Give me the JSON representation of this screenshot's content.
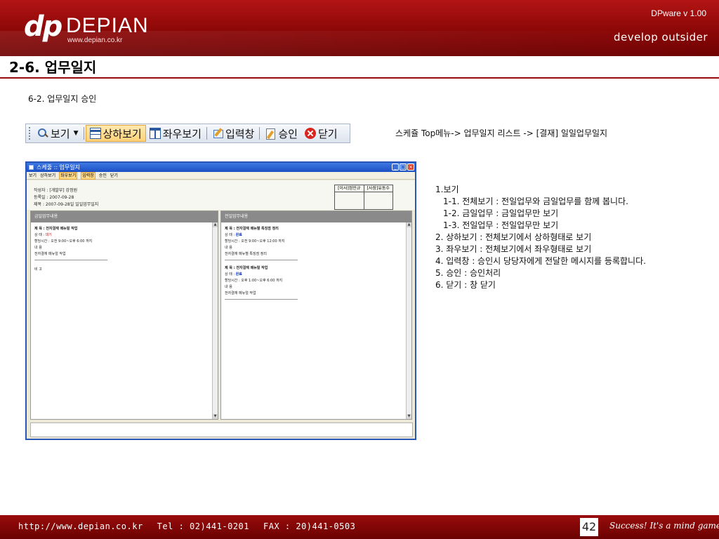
{
  "header": {
    "logo_mark": "dp",
    "logo_name": "DEPIAN",
    "logo_url": "www.depian.co.kr",
    "version": "DPware v 1.00",
    "tagline": "develop outsider"
  },
  "page": {
    "title": "2-6. 업무일지",
    "subtitle": "6-2. 업무일지 승인",
    "menu_path": "스케쥴 Top메뉴-> 업무일지 리스트 -> [결재] 일일업무일지"
  },
  "toolbar": {
    "view_label": "보기",
    "top_bottom_label": "상하보기",
    "left_right_label": "좌우보기",
    "input_label": "입력창",
    "approve_label": "승인",
    "close_label": "닫기"
  },
  "mini_window": {
    "title": "스케줄 :: 업무일지",
    "toolbar": {
      "view": "보기",
      "top_bottom": "상하보기",
      "left_right": "좌우보기",
      "input": "입력창",
      "approve": "승인",
      "close": "닫기"
    },
    "author": "작성자 : [개발부] 강정원",
    "reg_date": "등록일  :  2007-09-28",
    "subject": "제목  :  2007-09-28일  일일업무일지",
    "approvers": [
      "[이사]정민규",
      "[사장]유동수"
    ],
    "today_panel": {
      "header": "금일업무내용",
      "entries": [
        {
          "title": "제 목 : 전자결재 메뉴얼 작업",
          "status_label": "상 태 :",
          "status": "대기",
          "time": "할당시간 : 오전 9:00~오후 6:00 까지",
          "content_label": "내 용",
          "content": "전자결재 메뉴얼 작업"
        }
      ],
      "remark": "비 고"
    },
    "prev_panel": {
      "header": "전일업무내용",
      "entries": [
        {
          "title": "제 목 : 전자결재 메뉴별 특징점 정리",
          "status_label": "상 태 :",
          "status": "완료",
          "time": "할당시간 : 오전 9:00~오후 12:00 까지",
          "content_label": "내 용",
          "content": "전자결재 메뉴별 특징점 정리"
        },
        {
          "title": "제 목 : 전자결재 메뉴얼 작업",
          "status_label": "상 태 :",
          "status": "완료",
          "time": "할당시간 : 오후 1:00~오후 6:00 까지",
          "content_label": "내 용",
          "content": "전자결재 메뉴얼 작업"
        }
      ]
    }
  },
  "description": {
    "lines": [
      "1.보기",
      "1-1. 전체보기  : 전일업무와 금일업무를 함께 봅니다.",
      "1-2. 금일업무  : 금일업무만 보기",
      "1-3. 전일업무  : 전일업무만 보기",
      "2. 상하보기   : 전체보기에서 상하형태로 보기",
      "3. 좌우보기   : 전체보기에서 좌우형태로 보기",
      "4. 입력창   : 승인시 당당자에게 전달한 메시지를 등록합니다.",
      "5. 승인  : 승인처리",
      "6. 닫기  : 창 닫기"
    ]
  },
  "footer": {
    "url": "http://www.depian.co.kr",
    "tel": "Tel : 02)441-0201",
    "fax": "FAX : 20)441-0503",
    "slide_number": "42",
    "slogan": "Success! It's a mind game!"
  },
  "colors": {
    "brand_red": "#8c0707",
    "window_blue": "#2857b8"
  }
}
